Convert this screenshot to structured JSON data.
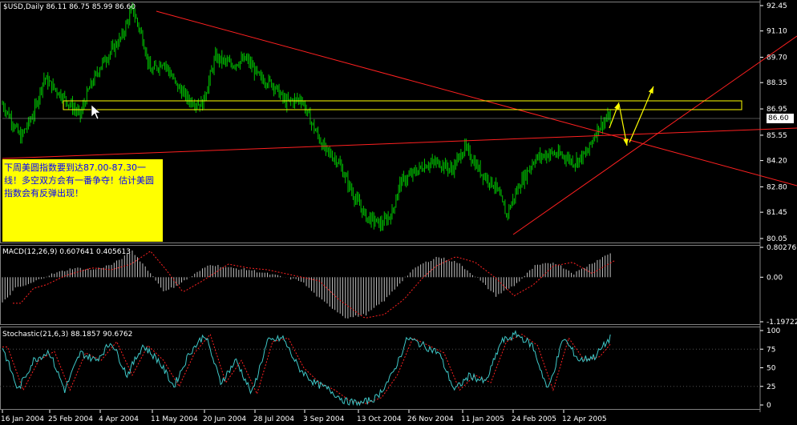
{
  "colors": {
    "candle": "#00c000",
    "trend": "#ff2020",
    "box": "#ffff00",
    "arrow": "#ffff00",
    "macd_hist": "#c0c0c0",
    "signal": "#ff2020",
    "stoch_main": "#3fc8c8",
    "stoch_signal": "#ff2020",
    "grid": "#505050"
  },
  "main": {
    "header": "$USD,Daily  86.11 86.75 85.99 86.60",
    "last_price": "86.60",
    "note": "下周美圆指数要到达87.00-87.30一线！多空双方会有一番争夺！估计美圆指数会有反弹出现！"
  },
  "macd": {
    "header": "MACD(12,26,9)  0.607641  0.405613"
  },
  "stoch": {
    "header": "Stochastic(21,6,3)  88.1857  90.6762"
  },
  "chart_data": [
    {
      "type": "candlestick",
      "name": "price",
      "ylim": [
        80.05,
        92.45
      ],
      "yticks": [
        "92.45",
        "91.10",
        "89.70",
        "88.35",
        "86.95",
        "85.55",
        "84.20",
        "82.80",
        "81.45",
        "80.05"
      ],
      "xticks": [
        "16 Jan 2004",
        "25 Feb 2004",
        "4 Apr 2004",
        "11 May 2004",
        "20 Jun 2004",
        "28 Jul 2004",
        "3 Sep 2004",
        "13 Oct 2004",
        "26 Nov 2004",
        "11 Jan 2005",
        "24 Feb 2005",
        "12 Apr 2005"
      ],
      "anchors": [
        [
          0,
          87.2
        ],
        [
          6,
          86.5
        ],
        [
          14,
          85.4
        ],
        [
          24,
          86.7
        ],
        [
          32,
          88.6
        ],
        [
          48,
          87.5
        ],
        [
          60,
          86.6
        ],
        [
          66,
          87.9
        ],
        [
          76,
          89.3
        ],
        [
          92,
          90.8
        ],
        [
          100,
          92.3
        ],
        [
          108,
          90.7
        ],
        [
          114,
          88.9
        ],
        [
          124,
          89.5
        ],
        [
          134,
          88.2
        ],
        [
          144,
          87.4
        ],
        [
          154,
          87.2
        ],
        [
          164,
          89.7
        ],
        [
          176,
          89.3
        ],
        [
          188,
          89.6
        ],
        [
          198,
          88.6
        ],
        [
          208,
          88.3
        ],
        [
          218,
          87.3
        ],
        [
          230,
          87.5
        ],
        [
          238,
          86.2
        ],
        [
          248,
          84.8
        ],
        [
          258,
          84.2
        ],
        [
          270,
          82.4
        ],
        [
          280,
          81.2
        ],
        [
          292,
          80.8
        ],
        [
          300,
          81.4
        ],
        [
          306,
          83.0
        ],
        [
          318,
          83.6
        ],
        [
          326,
          84.0
        ],
        [
          336,
          84.1
        ],
        [
          346,
          83.7
        ],
        [
          356,
          84.9
        ],
        [
          368,
          83.6
        ],
        [
          380,
          82.8
        ],
        [
          388,
          81.3
        ],
        [
          398,
          82.9
        ],
        [
          410,
          84.3
        ],
        [
          422,
          84.6
        ],
        [
          434,
          84.4
        ],
        [
          440,
          84.1
        ],
        [
          450,
          84.6
        ],
        [
          458,
          85.9
        ],
        [
          468,
          86.6
        ]
      ]
    },
    {
      "type": "histogram",
      "name": "MACD",
      "ylim": [
        -1.19722,
        0.80276
      ],
      "yticks": [
        "0.80276",
        "0.00",
        "-1.19722"
      ],
      "anchors": [
        [
          0,
          -0.7
        ],
        [
          10,
          -0.3
        ],
        [
          20,
          -0.2
        ],
        [
          35,
          0.05
        ],
        [
          55,
          0.25
        ],
        [
          70,
          0.2
        ],
        [
          85,
          0.35
        ],
        [
          100,
          0.7
        ],
        [
          112,
          0.2
        ],
        [
          125,
          -0.4
        ],
        [
          140,
          -0.1
        ],
        [
          160,
          0.35
        ],
        [
          175,
          0.25
        ],
        [
          190,
          0.2
        ],
        [
          210,
          0.05
        ],
        [
          230,
          -0.1
        ],
        [
          245,
          -0.6
        ],
        [
          265,
          -1.1
        ],
        [
          280,
          -1.0
        ],
        [
          295,
          -0.6
        ],
        [
          310,
          0.0
        ],
        [
          320,
          0.3
        ],
        [
          335,
          0.55
        ],
        [
          350,
          0.4
        ],
        [
          365,
          0.0
        ],
        [
          380,
          -0.5
        ],
        [
          395,
          -0.2
        ],
        [
          410,
          0.3
        ],
        [
          425,
          0.4
        ],
        [
          440,
          0.1
        ],
        [
          455,
          0.4
        ],
        [
          468,
          0.65
        ]
      ]
    },
    {
      "type": "line",
      "name": "Stochastic",
      "ylim": [
        0,
        100
      ],
      "yticks": [
        "100",
        "75",
        "50",
        "25",
        "0"
      ],
      "anchors": [
        [
          0,
          78
        ],
        [
          12,
          20
        ],
        [
          24,
          60
        ],
        [
          36,
          72
        ],
        [
          48,
          20
        ],
        [
          60,
          70
        ],
        [
          72,
          60
        ],
        [
          84,
          85
        ],
        [
          96,
          40
        ],
        [
          108,
          80
        ],
        [
          120,
          60
        ],
        [
          132,
          25
        ],
        [
          144,
          70
        ],
        [
          156,
          95
        ],
        [
          168,
          30
        ],
        [
          180,
          60
        ],
        [
          192,
          15
        ],
        [
          204,
          85
        ],
        [
          216,
          90
        ],
        [
          228,
          50
        ],
        [
          240,
          30
        ],
        [
          252,
          20
        ],
        [
          264,
          5
        ],
        [
          276,
          2
        ],
        [
          288,
          10
        ],
        [
          300,
          40
        ],
        [
          312,
          90
        ],
        [
          324,
          80
        ],
        [
          336,
          70
        ],
        [
          348,
          20
        ],
        [
          360,
          40
        ],
        [
          372,
          30
        ],
        [
          384,
          85
        ],
        [
          396,
          95
        ],
        [
          408,
          80
        ],
        [
          420,
          20
        ],
        [
          432,
          90
        ],
        [
          444,
          60
        ],
        [
          456,
          65
        ],
        [
          468,
          90
        ]
      ]
    }
  ]
}
